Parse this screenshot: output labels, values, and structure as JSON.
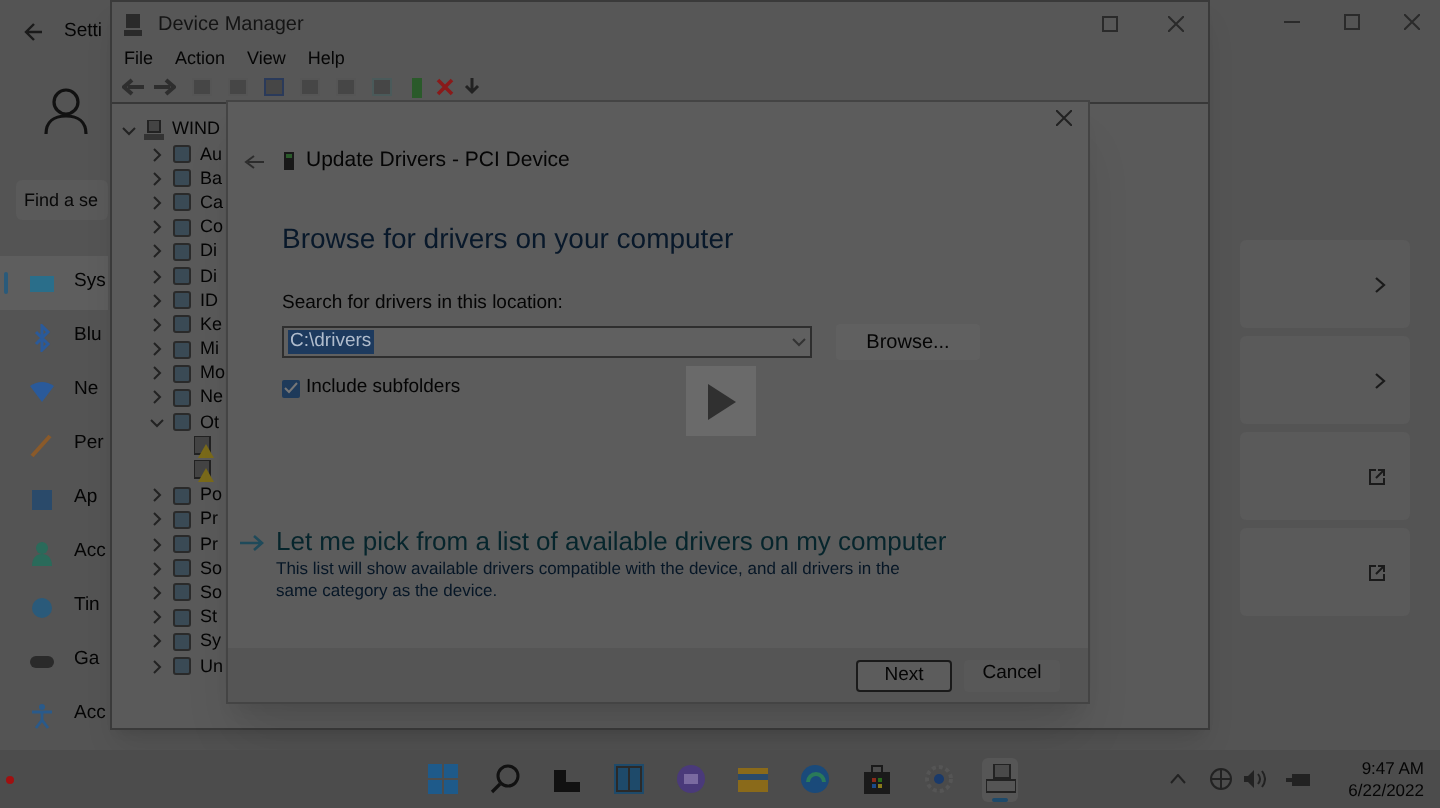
{
  "settings_window": {
    "title": "Setti",
    "search": {
      "placeholder": "Find a se"
    },
    "nav_items": [
      {
        "label": "Sys",
        "kind": "system",
        "selected": true
      },
      {
        "label": "Blu",
        "kind": "bluetooth",
        "selected": false
      },
      {
        "label": "Ne",
        "kind": "network",
        "selected": false
      },
      {
        "label": "Per",
        "kind": "brush",
        "selected": false
      },
      {
        "label": "Ap",
        "kind": "apps",
        "selected": false
      },
      {
        "label": "Acc",
        "kind": "person",
        "selected": false
      },
      {
        "label": "Tin",
        "kind": "globe",
        "selected": false
      },
      {
        "label": "Ga",
        "kind": "gamepad",
        "selected": false
      },
      {
        "label": "Acc",
        "kind": "accessibility",
        "selected": false
      }
    ],
    "cards": [
      {
        "kind": "chevron"
      },
      {
        "kind": "chevron"
      },
      {
        "kind": "external"
      },
      {
        "kind": "external"
      }
    ]
  },
  "device_manager": {
    "title": "Device Manager",
    "menu": [
      "File",
      "Action",
      "View",
      "Help"
    ],
    "tree": {
      "label": "WIND",
      "expanded": true,
      "children": [
        {
          "label": "Au",
          "expanded": false
        },
        {
          "label": "Ba",
          "expanded": false
        },
        {
          "label": "Ca",
          "expanded": false
        },
        {
          "label": "Co",
          "expanded": false
        },
        {
          "label": "Di",
          "expanded": false
        },
        {
          "label": "Di",
          "expanded": false
        },
        {
          "label": "ID",
          "expanded": false
        },
        {
          "label": "Ke",
          "expanded": false
        },
        {
          "label": "Mi",
          "expanded": false
        },
        {
          "label": "Mo",
          "expanded": false
        },
        {
          "label": "Ne",
          "expanded": false
        },
        {
          "label": "Ot",
          "expanded": true,
          "children": [
            {
              "kind": "unknown-device"
            },
            {
              "kind": "unknown-device"
            }
          ]
        },
        {
          "label": "Po",
          "expanded": false
        },
        {
          "label": "Pr",
          "expanded": false
        },
        {
          "label": "Pr",
          "expanded": false
        },
        {
          "label": "So",
          "expanded": false
        },
        {
          "label": "So",
          "expanded": false
        },
        {
          "label": "St",
          "expanded": false
        },
        {
          "label": "Sy",
          "expanded": false
        },
        {
          "label": "Un",
          "expanded": false
        }
      ]
    }
  },
  "dialog": {
    "title": "Update Drivers - PCI Device",
    "heading": "Browse for drivers on your computer",
    "location_label": "Search for drivers in this location:",
    "location_field": {
      "value": "C:\\drivers",
      "text_selected": true
    },
    "browse_button": "Browse...",
    "include_subfolders": {
      "label": "Include subfolders",
      "checked": true
    },
    "pick_link": {
      "label": "Let me pick from a list of available drivers on my computer",
      "description": "This list will show available drivers compatible with the device, and all drivers in the same category as the device."
    },
    "buttons": [
      {
        "label": "Next",
        "default": true
      },
      {
        "label": "Cancel",
        "default": false
      }
    ]
  },
  "taskbar": {
    "apps": [
      {
        "kind": "start",
        "active": false
      },
      {
        "kind": "search",
        "active": false
      },
      {
        "kind": "task-view",
        "active": false
      },
      {
        "kind": "snap",
        "active": false
      },
      {
        "kind": "chat",
        "active": false
      },
      {
        "kind": "folder",
        "active": false
      },
      {
        "kind": "browser",
        "active": false
      },
      {
        "kind": "store",
        "active": false
      },
      {
        "kind": "gear",
        "active": false
      },
      {
        "kind": "device-manager",
        "active": true
      }
    ],
    "time": "9:47 AM",
    "date": "6/22/2022"
  }
}
